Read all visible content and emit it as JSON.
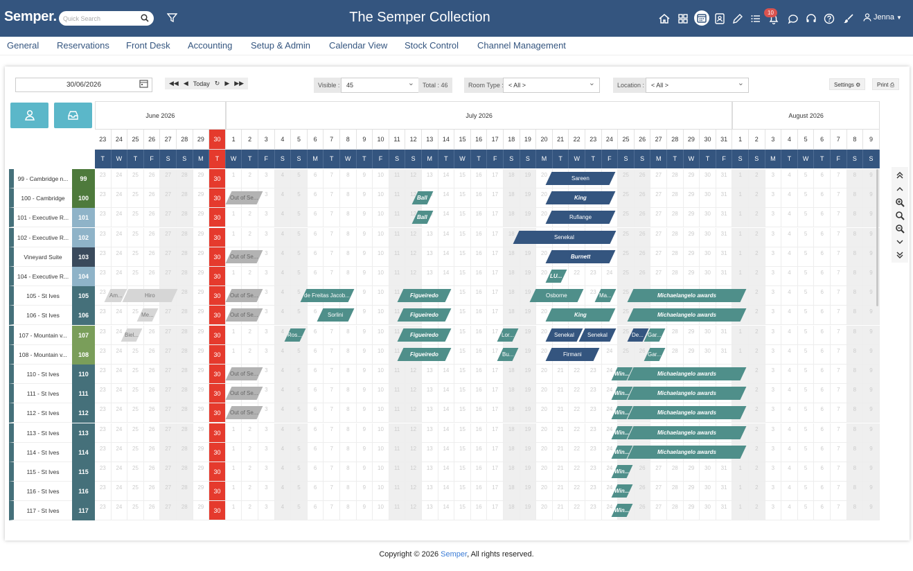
{
  "header": {
    "logo": "Semper.",
    "search_placeholder": "Quick Search",
    "title": "The Semper Collection",
    "notifications": "10",
    "user": "Jenna",
    "icons": [
      "home-icon",
      "grid-icon",
      "calendar-icon",
      "contacts-icon",
      "pencil-icon",
      "list-icon",
      "bell-icon",
      "chat-icon",
      "headset-icon",
      "help-icon",
      "brush-icon",
      "user-icon"
    ]
  },
  "menu": [
    "General",
    "Reservations",
    "Front Desk",
    "Accounting",
    "Setup & Admin",
    "Calendar View",
    "Stock Control",
    "Channel Management"
  ],
  "toolbar": {
    "date": "30/06/2026",
    "today": "Today",
    "visible_label": "Visible :",
    "visible_value": "45",
    "total": "Total : 46",
    "roomtype_label": "Room Type :",
    "roomtype_value": "< All >",
    "location_label": "Location :",
    "location_value": "< All >",
    "settings": "Settings",
    "print": "Print"
  },
  "months": [
    "June 2026",
    "July 2026",
    "August 2026"
  ],
  "days": [
    {
      "n": "23",
      "d": "T"
    },
    {
      "n": "24",
      "d": "W"
    },
    {
      "n": "25",
      "d": "T"
    },
    {
      "n": "26",
      "d": "F"
    },
    {
      "n": "27",
      "d": "S"
    },
    {
      "n": "28",
      "d": "S"
    },
    {
      "n": "29",
      "d": "M"
    },
    {
      "n": "30",
      "d": "T"
    },
    {
      "n": "1",
      "d": "W"
    },
    {
      "n": "2",
      "d": "T"
    },
    {
      "n": "3",
      "d": "F"
    },
    {
      "n": "4",
      "d": "S"
    },
    {
      "n": "5",
      "d": "S"
    },
    {
      "n": "6",
      "d": "M"
    },
    {
      "n": "7",
      "d": "T"
    },
    {
      "n": "8",
      "d": "W"
    },
    {
      "n": "9",
      "d": "T"
    },
    {
      "n": "10",
      "d": "F"
    },
    {
      "n": "11",
      "d": "S"
    },
    {
      "n": "12",
      "d": "S"
    },
    {
      "n": "13",
      "d": "M"
    },
    {
      "n": "14",
      "d": "T"
    },
    {
      "n": "15",
      "d": "W"
    },
    {
      "n": "16",
      "d": "T"
    },
    {
      "n": "17",
      "d": "F"
    },
    {
      "n": "18",
      "d": "S"
    },
    {
      "n": "19",
      "d": "S"
    },
    {
      "n": "20",
      "d": "M"
    },
    {
      "n": "21",
      "d": "T"
    },
    {
      "n": "22",
      "d": "W"
    },
    {
      "n": "23",
      "d": "T"
    },
    {
      "n": "24",
      "d": "F"
    },
    {
      "n": "25",
      "d": "S"
    },
    {
      "n": "26",
      "d": "S"
    },
    {
      "n": "27",
      "d": "M"
    },
    {
      "n": "28",
      "d": "T"
    },
    {
      "n": "29",
      "d": "W"
    },
    {
      "n": "30",
      "d": "T"
    },
    {
      "n": "31",
      "d": "F"
    },
    {
      "n": "1",
      "d": "S"
    },
    {
      "n": "2",
      "d": "S"
    },
    {
      "n": "3",
      "d": "M"
    },
    {
      "n": "4",
      "d": "T"
    },
    {
      "n": "5",
      "d": "W"
    },
    {
      "n": "6",
      "d": "T"
    },
    {
      "n": "7",
      "d": "F"
    },
    {
      "n": "8",
      "d": "S"
    },
    {
      "n": "9",
      "d": "S"
    }
  ],
  "today_index": 7,
  "rooms": [
    {
      "name": "99 - Cambridge n...",
      "code": "99",
      "color": "#4e7a3c"
    },
    {
      "name": "100 - Cambridge",
      "code": "100",
      "color": "#4e7a3c"
    },
    {
      "name": "101 - Executive R...",
      "code": "101",
      "color": "#8fb3c8"
    },
    {
      "name": "102 - Executive R...",
      "code": "102",
      "color": "#8fb3c8"
    },
    {
      "name": "Vineyard Suite",
      "code": "103",
      "color": "#3a4a5c"
    },
    {
      "name": "104 - Executive R...",
      "code": "104",
      "color": "#8fb3c8"
    },
    {
      "name": "105 - St Ives",
      "code": "105",
      "color": "#45707a"
    },
    {
      "name": "106 - St Ives",
      "code": "106",
      "color": "#45707a"
    },
    {
      "name": "107 - Mountain v...",
      "code": "107",
      "color": "#7a9e5a"
    },
    {
      "name": "108 - Mountain v...",
      "code": "108",
      "color": "#7a9e5a"
    },
    {
      "name": "110 - St Ives",
      "code": "110",
      "color": "#45707a"
    },
    {
      "name": "111 - St Ives",
      "code": "111",
      "color": "#45707a"
    },
    {
      "name": "112 - St Ives",
      "code": "112",
      "color": "#45707a"
    },
    {
      "name": "113 - St Ives",
      "code": "113",
      "color": "#45707a"
    },
    {
      "name": "114 - St Ives",
      "code": "114",
      "color": "#45707a"
    },
    {
      "name": "115 - St Ives",
      "code": "115",
      "color": "#45707a"
    },
    {
      "name": "116 - St Ives",
      "code": "116",
      "color": "#45707a"
    },
    {
      "name": "117 - St Ives",
      "code": "117",
      "color": "#45707a"
    }
  ],
  "bookings": [
    {
      "room": 0,
      "start": 27.6,
      "len": 4,
      "label": "Sareen",
      "style": "navy"
    },
    {
      "room": 1,
      "start": 8,
      "len": 2,
      "label": "Out of Se...",
      "style": "grey"
    },
    {
      "room": 1,
      "start": 19.4,
      "len": 1,
      "label": "Ball",
      "style": "teal",
      "it": true
    },
    {
      "room": 1,
      "start": 27.6,
      "len": 4,
      "label": "King",
      "style": "navy",
      "it": true
    },
    {
      "room": 2,
      "start": 19.4,
      "len": 1,
      "label": "Ball",
      "style": "teal",
      "it": true
    },
    {
      "room": 2,
      "start": 27.6,
      "len": 4,
      "label": "Rufiange",
      "style": "navy"
    },
    {
      "room": 3,
      "start": 25.6,
      "len": 6,
      "label": "Senekal",
      "style": "navy"
    },
    {
      "room": 4,
      "start": 8,
      "len": 2,
      "label": "Out of Se...",
      "style": "grey"
    },
    {
      "room": 4,
      "start": 27.6,
      "len": 4,
      "label": "Burnett",
      "style": "navy",
      "it": true
    },
    {
      "room": 5,
      "start": 27.6,
      "len": 1,
      "label": "LU...",
      "style": "teal",
      "it": true
    },
    {
      "room": 6,
      "start": 0.6,
      "len": 1.1,
      "label": "Am...",
      "style": "light"
    },
    {
      "room": 6,
      "start": 1.7,
      "len": 3.1,
      "label": "Hiro",
      "style": "light"
    },
    {
      "room": 6,
      "start": 8,
      "len": 2,
      "label": "Out of Se...",
      "style": "grey"
    },
    {
      "room": 6,
      "start": 12.6,
      "len": 3,
      "label": "de Freitas Jacob...",
      "style": "teal"
    },
    {
      "room": 6,
      "start": 18.5,
      "len": 3,
      "label": "Figueiredo",
      "style": "teal",
      "it": true
    },
    {
      "room": 6,
      "start": 26.6,
      "len": 3,
      "label": "Osborne",
      "style": "teal"
    },
    {
      "room": 6,
      "start": 30.6,
      "len": 1,
      "label": "Ma...",
      "style": "teal"
    },
    {
      "room": 6,
      "start": 32.6,
      "len": 7,
      "label": "Michaelangelo awards",
      "style": "teal",
      "it": true
    },
    {
      "room": 7,
      "start": 2.6,
      "len": 1,
      "label": "Me...",
      "style": "light"
    },
    {
      "room": 7,
      "start": 8,
      "len": 2,
      "label": "Out of Se...",
      "style": "grey"
    },
    {
      "room": 7,
      "start": 13.6,
      "len": 2,
      "label": "Sorlini",
      "style": "teal"
    },
    {
      "room": 7,
      "start": 18.5,
      "len": 3,
      "label": "Figueiredo",
      "style": "teal",
      "it": true
    },
    {
      "room": 7,
      "start": 27.6,
      "len": 4,
      "label": "King",
      "style": "teal",
      "it": true
    },
    {
      "room": 7,
      "start": 32.6,
      "len": 7,
      "label": "Michaelangelo awards",
      "style": "teal",
      "it": true
    },
    {
      "room": 8,
      "start": 1.6,
      "len": 1,
      "label": "Biel...",
      "style": "light"
    },
    {
      "room": 8,
      "start": 11.6,
      "len": 1,
      "label": "Ros...",
      "style": "teal"
    },
    {
      "room": 8,
      "start": 18.5,
      "len": 3,
      "label": "Figueiredo",
      "style": "teal",
      "it": true
    },
    {
      "room": 8,
      "start": 24.6,
      "len": 1,
      "label": "Lor...",
      "style": "teal"
    },
    {
      "room": 8,
      "start": 27.6,
      "len": 2,
      "label": "Senekal",
      "style": "navy"
    },
    {
      "room": 8,
      "start": 29.6,
      "len": 2,
      "label": "Senekal",
      "style": "navy"
    },
    {
      "room": 8,
      "start": 32.6,
      "len": 1,
      "label": "De...",
      "style": "navy"
    },
    {
      "room": 8,
      "start": 33.6,
      "len": 1,
      "label": "Gar...",
      "style": "teal"
    },
    {
      "room": 9,
      "start": 18.5,
      "len": 3,
      "label": "Figueiredo",
      "style": "teal",
      "it": true
    },
    {
      "room": 9,
      "start": 24.6,
      "len": 1,
      "label": "Bu...",
      "style": "teal"
    },
    {
      "room": 9,
      "start": 27.6,
      "len": 3,
      "label": "Firmani",
      "style": "navy"
    },
    {
      "room": 9,
      "start": 33.6,
      "len": 1,
      "label": "Gar...",
      "style": "teal"
    },
    {
      "room": 10,
      "start": 8,
      "len": 2,
      "label": "Out of Se...",
      "style": "grey"
    },
    {
      "room": 10,
      "start": 31.6,
      "len": 1,
      "label": "Win...",
      "style": "teal",
      "it": true
    },
    {
      "room": 10,
      "start": 32.6,
      "len": 7,
      "label": "Michaelangelo awards",
      "style": "teal",
      "it": true
    },
    {
      "room": 11,
      "start": 8,
      "len": 2,
      "label": "Out of Se...",
      "style": "grey"
    },
    {
      "room": 11,
      "start": 31.6,
      "len": 1,
      "label": "Win...",
      "style": "teal",
      "it": true
    },
    {
      "room": 11,
      "start": 32.6,
      "len": 7,
      "label": "Michaelangelo awards",
      "style": "teal",
      "it": true
    },
    {
      "room": 12,
      "start": 8,
      "len": 2,
      "label": "Out of Se...",
      "style": "grey"
    },
    {
      "room": 12,
      "start": 31.6,
      "len": 1,
      "label": "Win...",
      "style": "teal",
      "it": true
    },
    {
      "room": 12,
      "start": 32.6,
      "len": 7,
      "label": "Michaelangelo awards",
      "style": "teal",
      "it": true
    },
    {
      "room": 13,
      "start": 31.6,
      "len": 1,
      "label": "Win...",
      "style": "teal",
      "it": true
    },
    {
      "room": 13,
      "start": 32.6,
      "len": 7,
      "label": "Michaelangelo awards",
      "style": "teal",
      "it": true
    },
    {
      "room": 14,
      "start": 31.6,
      "len": 1,
      "label": "Win...",
      "style": "teal",
      "it": true
    },
    {
      "room": 14,
      "start": 32.6,
      "len": 7,
      "label": "Michaelangelo awards",
      "style": "teal",
      "it": true
    },
    {
      "room": 15,
      "start": 31.6,
      "len": 1,
      "label": "Win...",
      "style": "teal",
      "it": true
    },
    {
      "room": 16,
      "start": 31.6,
      "len": 1,
      "label": "Win...",
      "style": "teal",
      "it": true
    },
    {
      "room": 17,
      "start": 31.6,
      "len": 1,
      "label": "Win...",
      "style": "teal",
      "it": true
    }
  ],
  "footer": {
    "prefix": "Copyright © 2026 ",
    "brand": "Semper",
    "suffix": ", All rights reserved."
  }
}
